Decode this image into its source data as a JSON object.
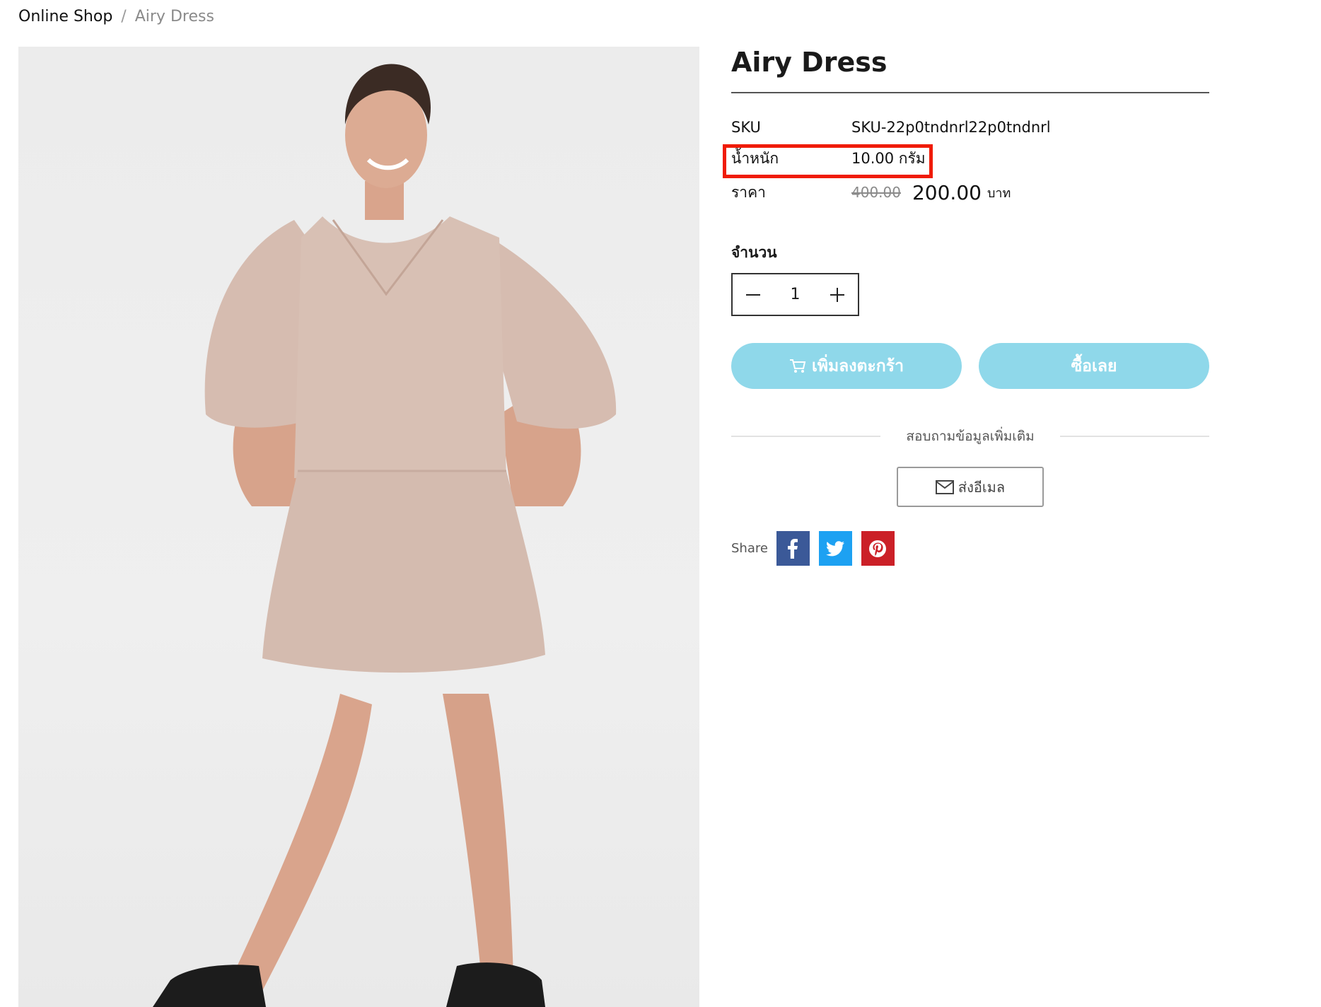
{
  "breadcrumb": {
    "home": "Online Shop",
    "separator": "/",
    "current": "Airy Dress"
  },
  "product": {
    "title": "Airy Dress",
    "image_alt": "Model wearing a beige airy dress and black sandals",
    "specs": {
      "sku_label": "SKU",
      "sku_value": "SKU-22p0tndnrl22p0tndnrl",
      "weight_label": "น้ำหนัก",
      "weight_value": "10.00 กรัม",
      "price_label": "ราคา",
      "price_old": "400.00",
      "price_new": "200.00",
      "price_unit": "บาท"
    },
    "quantity": {
      "label": "จำนวน",
      "value": "1"
    },
    "buttons": {
      "add_to_cart": "เพิ่มลงตะกร้า",
      "buy_now": "ซื้อเลย"
    },
    "inquiry": {
      "text": "สอบถามข้อมูลเพิ่มเติม",
      "email_button": "ส่งอีเมล"
    },
    "share": {
      "label": "Share",
      "networks": [
        "facebook",
        "twitter",
        "pinterest"
      ]
    }
  },
  "colors": {
    "button_accent": "#8fd8ea",
    "highlight": "#f01b06",
    "facebook": "#3b5998",
    "twitter": "#1da1f2",
    "pinterest": "#cb2027"
  }
}
